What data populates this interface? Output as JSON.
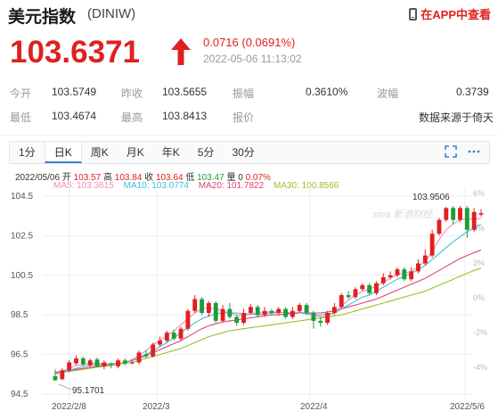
{
  "header": {
    "title": "美元指数",
    "code": "(DINIW)",
    "app_link": "在APP中查看"
  },
  "quote": {
    "price": "103.6371",
    "change": "0.0716 (0.0691%)",
    "time": "2022-05-06 11:13:02"
  },
  "stats": {
    "open_label": "今开",
    "open_value": "103.5749",
    "prev_close_label": "昨收",
    "prev_close_value": "103.5655",
    "amplitude_label": "振幅",
    "amplitude_value": "0.3610%",
    "volatility_label": "波幅",
    "volatility_value": "0.3739",
    "low_label": "最低",
    "low_value": "103.4674",
    "high_label": "最高",
    "high_value": "103.8413",
    "quote_label": "报价",
    "quote_value": "数据来源于倚天"
  },
  "tabs": [
    "1分",
    "日K",
    "周K",
    "月K",
    "年K",
    "5分",
    "30分"
  ],
  "active_tab": "日K",
  "info_line": {
    "date": "2022/05/06",
    "open_label": "开",
    "open": "103.57",
    "high_label": "高",
    "high": "103.84",
    "close_label": "收",
    "close": "103.64",
    "low_label": "低",
    "low": "103.47",
    "vol_label": "量",
    "vol": "0",
    "pct": "0.07%"
  },
  "ma": {
    "ma5": "MA5: 103.3615",
    "ma10": "MA10: 103.0774",
    "ma20": "MA20: 101.7822",
    "ma30": "MA30: 100.8566"
  },
  "watermark": "sina 新浪财经",
  "colors": {
    "up": "#e02020",
    "down": "#1a9e3a",
    "accent": "#3b82d6",
    "ma5": "#f08fb0",
    "ma10": "#3ec1d3",
    "ma20": "#e0407a",
    "ma30": "#9bbf2e"
  },
  "chart_data": {
    "type": "candlestick",
    "y_ticks": [
      "104.5",
      "102.5",
      "100.5",
      "98.5",
      "96.5",
      "94.5"
    ],
    "right_ticks": [
      "6%",
      "4%",
      "2%",
      "0%",
      "-2%",
      "-4%",
      "-6%"
    ],
    "x_labels": [
      "2022/2/8",
      "2022/3",
      "2022/4",
      "2022/5/6"
    ],
    "ylim": [
      94.5,
      104.5
    ],
    "annotations": {
      "max": "103.9506",
      "min": "95.1701"
    },
    "candles": [
      [
        95.4,
        95.2,
        95.75,
        95.17
      ],
      [
        95.25,
        95.7,
        95.8,
        95.2
      ],
      [
        95.7,
        96.1,
        96.2,
        95.6
      ],
      [
        96.05,
        96.3,
        96.45,
        95.95
      ],
      [
        96.3,
        96.0,
        96.4,
        95.9
      ],
      [
        95.95,
        96.2,
        96.3,
        95.85
      ],
      [
        96.25,
        95.9,
        96.35,
        95.85
      ],
      [
        95.9,
        96.1,
        96.2,
        95.75
      ],
      [
        96.0,
        95.95,
        96.1,
        95.8
      ],
      [
        95.9,
        96.2,
        96.3,
        95.8
      ],
      [
        96.2,
        96.05,
        96.3,
        95.95
      ],
      [
        96.05,
        96.1,
        96.25,
        96.0
      ],
      [
        96.1,
        96.6,
        96.7,
        96.0
      ],
      [
        96.5,
        96.4,
        96.7,
        96.3
      ],
      [
        96.4,
        97.0,
        97.1,
        96.35
      ],
      [
        97.0,
        97.2,
        97.4,
        96.9
      ],
      [
        97.2,
        97.6,
        97.7,
        97.1
      ],
      [
        97.6,
        97.3,
        97.75,
        97.2
      ],
      [
        97.3,
        97.8,
        97.9,
        97.2
      ],
      [
        97.8,
        98.7,
        98.8,
        97.7
      ],
      [
        98.7,
        99.3,
        99.5,
        98.6
      ],
      [
        99.3,
        98.6,
        99.4,
        98.5
      ],
      [
        98.6,
        99.1,
        99.2,
        98.4
      ],
      [
        99.1,
        98.2,
        99.2,
        98.1
      ],
      [
        98.2,
        98.8,
        99.0,
        98.1
      ],
      [
        98.8,
        98.4,
        99.1,
        98.3
      ],
      [
        98.4,
        98.1,
        98.5,
        97.95
      ],
      [
        98.1,
        98.6,
        98.8,
        98.0
      ],
      [
        98.6,
        98.9,
        99.05,
        98.5
      ],
      [
        98.9,
        98.5,
        99.0,
        98.4
      ],
      [
        98.5,
        98.7,
        98.9,
        98.4
      ],
      [
        98.7,
        98.6,
        98.8,
        98.5
      ],
      [
        98.6,
        98.8,
        98.9,
        98.5
      ],
      [
        98.8,
        98.4,
        98.9,
        98.3
      ],
      [
        98.4,
        98.7,
        98.9,
        98.3
      ],
      [
        98.7,
        99.0,
        99.1,
        98.6
      ],
      [
        99.0,
        98.6,
        99.1,
        98.5
      ],
      [
        98.6,
        98.2,
        98.7,
        97.8
      ],
      [
        98.2,
        98.1,
        98.4,
        97.9
      ],
      [
        98.1,
        98.6,
        98.7,
        98.0
      ],
      [
        98.6,
        98.9,
        99.1,
        98.5
      ],
      [
        98.9,
        99.5,
        99.6,
        98.8
      ],
      [
        99.5,
        99.4,
        99.7,
        99.3
      ],
      [
        99.4,
        99.8,
        99.9,
        99.3
      ],
      [
        99.8,
        100.0,
        100.1,
        99.7
      ],
      [
        100.0,
        99.6,
        100.1,
        99.5
      ],
      [
        99.6,
        100.1,
        100.2,
        99.5
      ],
      [
        100.1,
        100.4,
        100.6,
        100.0
      ],
      [
        100.4,
        100.5,
        100.7,
        100.3
      ],
      [
        100.5,
        100.8,
        100.9,
        100.4
      ],
      [
        100.8,
        100.3,
        100.9,
        100.2
      ],
      [
        100.3,
        100.7,
        100.9,
        100.2
      ],
      [
        100.7,
        101.1,
        101.3,
        100.6
      ],
      [
        101.1,
        101.5,
        101.8,
        101.0
      ],
      [
        101.5,
        102.6,
        102.8,
        101.4
      ],
      [
        102.6,
        103.3,
        103.4,
        102.5
      ],
      [
        103.3,
        103.9,
        103.95,
        103.2
      ],
      [
        103.9,
        103.3,
        104.0,
        103.1
      ],
      [
        103.3,
        103.9,
        104.0,
        103.2
      ],
      [
        103.9,
        102.8,
        104.0,
        102.4
      ],
      [
        102.8,
        103.7,
        103.9,
        102.7
      ],
      [
        103.57,
        103.64,
        103.84,
        103.47
      ]
    ],
    "ma_series": {
      "ma30": [
        95.55,
        95.6,
        95.65,
        95.7,
        95.75,
        95.8,
        95.85,
        95.9,
        95.95,
        96.0,
        96.05,
        96.1,
        96.2,
        96.3,
        96.4,
        96.5,
        96.6,
        96.7,
        96.8,
        96.95,
        97.1,
        97.25,
        97.4,
        97.5,
        97.6,
        97.7,
        97.75,
        97.8,
        97.85,
        97.9,
        97.95,
        98.0,
        98.05,
        98.1,
        98.15,
        98.2,
        98.25,
        98.3,
        98.35,
        98.4,
        98.45,
        98.5,
        98.6,
        98.7,
        98.8,
        98.9,
        99.0,
        99.1,
        99.2,
        99.3,
        99.4,
        99.5,
        99.6,
        99.7,
        99.85,
        100.0,
        100.15,
        100.3,
        100.45,
        100.6,
        100.75,
        100.86
      ],
      "ma20": [
        95.6,
        95.65,
        95.7,
        95.75,
        95.8,
        95.85,
        95.9,
        95.95,
        96.0,
        96.05,
        96.1,
        96.2,
        96.3,
        96.45,
        96.6,
        96.75,
        96.9,
        97.05,
        97.2,
        97.4,
        97.6,
        97.8,
        97.95,
        98.05,
        98.15,
        98.2,
        98.25,
        98.3,
        98.35,
        98.4,
        98.45,
        98.5,
        98.5,
        98.55,
        98.55,
        98.6,
        98.6,
        98.6,
        98.6,
        98.65,
        98.7,
        98.8,
        98.9,
        99.0,
        99.1,
        99.2,
        99.3,
        99.45,
        99.6,
        99.75,
        99.9,
        100.05,
        100.2,
        100.35,
        100.55,
        100.75,
        100.95,
        101.15,
        101.35,
        101.5,
        101.65,
        101.78
      ],
      "ma10": [
        95.5,
        95.6,
        95.7,
        95.8,
        95.9,
        95.95,
        96.0,
        96.0,
        96.05,
        96.05,
        96.1,
        96.2,
        96.35,
        96.5,
        96.7,
        96.9,
        97.1,
        97.35,
        97.6,
        97.85,
        98.1,
        98.3,
        98.45,
        98.55,
        98.6,
        98.6,
        98.6,
        98.55,
        98.55,
        98.5,
        98.55,
        98.6,
        98.6,
        98.65,
        98.6,
        98.6,
        98.55,
        98.5,
        98.5,
        98.55,
        98.6,
        98.8,
        99.0,
        99.2,
        99.4,
        99.5,
        99.7,
        99.9,
        100.1,
        100.3,
        100.45,
        100.6,
        100.8,
        101.0,
        101.3,
        101.6,
        101.9,
        102.2,
        102.45,
        102.7,
        102.9,
        103.08
      ],
      "ma5": [
        95.5,
        95.65,
        95.8,
        95.95,
        96.0,
        96.05,
        96.05,
        96.05,
        96.0,
        96.05,
        96.1,
        96.25,
        96.45,
        96.7,
        97.0,
        97.2,
        97.45,
        97.7,
        98.0,
        98.3,
        98.6,
        98.8,
        98.85,
        98.8,
        98.7,
        98.6,
        98.5,
        98.45,
        98.55,
        98.6,
        98.65,
        98.65,
        98.65,
        98.6,
        98.6,
        98.65,
        98.6,
        98.5,
        98.4,
        98.45,
        98.6,
        98.95,
        99.25,
        99.5,
        99.7,
        99.8,
        99.95,
        100.15,
        100.35,
        100.55,
        100.6,
        100.7,
        100.95,
        101.2,
        101.7,
        102.3,
        102.8,
        103.1,
        103.3,
        103.35,
        103.35,
        103.36
      ]
    }
  }
}
